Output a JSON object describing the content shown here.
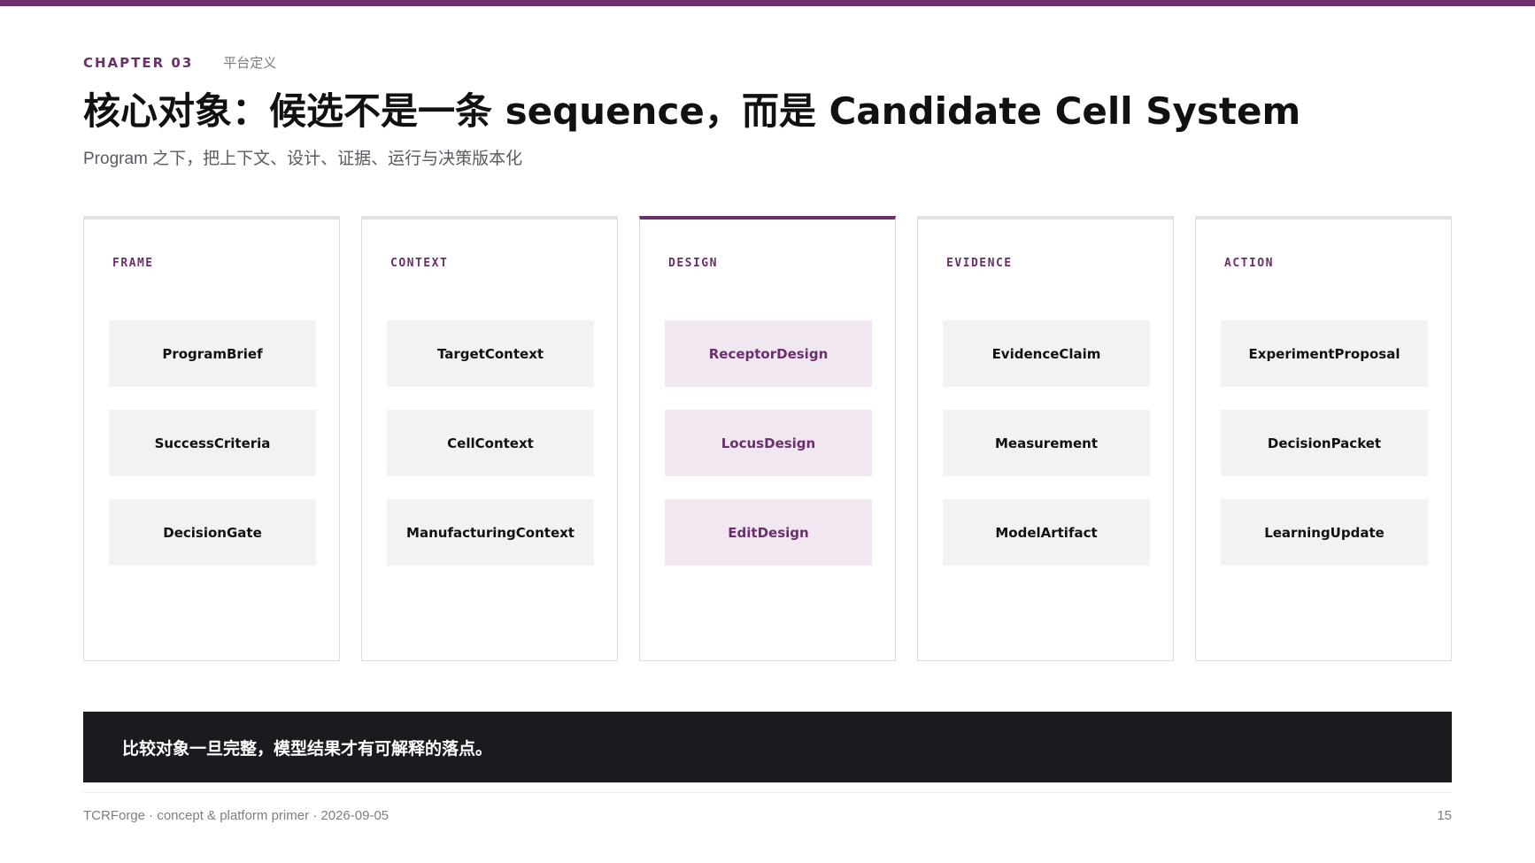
{
  "header": {
    "chapter": "CHAPTER 03",
    "section": "平台定义",
    "title": "核心对象：候选不是一条 sequence，而是 Candidate Cell System",
    "subtitle": "Program 之下，把上下文、设计、证据、运行与决策版本化"
  },
  "columns": [
    {
      "label": "FRAME",
      "items": [
        "ProgramBrief",
        "SuccessCriteria",
        "DecisionGate"
      ]
    },
    {
      "label": "CONTEXT",
      "items": [
        "TargetContext",
        "CellContext",
        "ManufacturingContext"
      ]
    },
    {
      "label": "DESIGN",
      "items": [
        "ReceptorDesign",
        "LocusDesign",
        "EditDesign"
      ],
      "highlighted": true
    },
    {
      "label": "EVIDENCE",
      "items": [
        "EvidenceClaim",
        "Measurement",
        "ModelArtifact"
      ]
    },
    {
      "label": "ACTION",
      "items": [
        "ExperimentProposal",
        "DecisionPacket",
        "LearningUpdate"
      ]
    }
  ],
  "callout": {
    "text": "比较对象一旦完整，模型结果才有可解释的落点。"
  },
  "footer": {
    "left": "TCRForge · concept & platform primer · 2026-09-05",
    "page_number": "15"
  },
  "colors": {
    "accent": "#6b2f6e",
    "chip_background": "#f3f1f4",
    "chip_highlight_background": "#f1e7f1",
    "callout_background": "#1b1a1f"
  }
}
